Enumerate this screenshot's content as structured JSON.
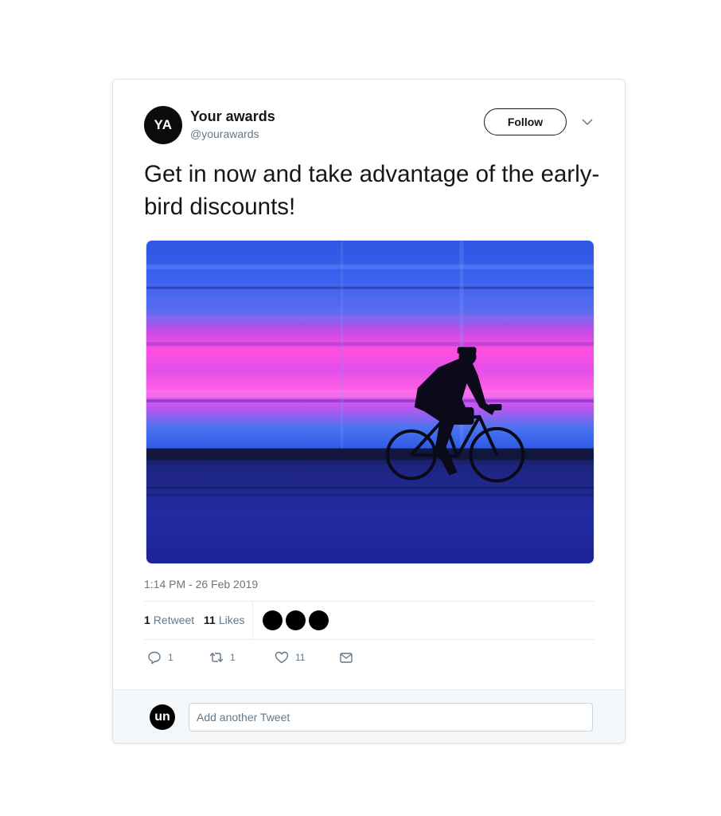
{
  "tweet": {
    "author": {
      "avatar_initials": "YA",
      "name": "Your awards",
      "handle": "@yourawards"
    },
    "follow_label": "Follow",
    "text": "Get in now and take advantage of the early-bird discounts!",
    "timestamp": "1:14 PM - 26 Feb 2019",
    "stats": {
      "retweets_count": "1",
      "retweets_label": "Retweet",
      "likes_count": "11",
      "likes_label": "Likes"
    },
    "actions": {
      "reply_count": "1",
      "retweet_count": "1",
      "like_count": "11"
    }
  },
  "reply": {
    "avatar_initials": "un",
    "placeholder": "Add another Tweet"
  },
  "icons": [
    "chevron-down-icon",
    "reply-icon",
    "retweet-icon",
    "heart-icon",
    "envelope-icon"
  ],
  "colors": {
    "text_primary": "#14171a",
    "text_secondary": "#657786",
    "border": "#e6ecf0",
    "reply_bar_bg": "#f5f8fa"
  }
}
